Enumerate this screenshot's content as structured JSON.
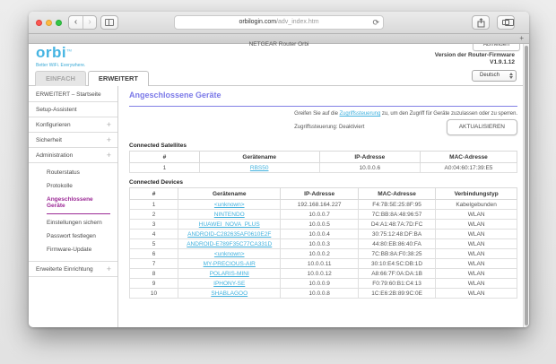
{
  "browser": {
    "url_domain": "orbilogin.com",
    "url_path": "/adv_index.htm",
    "tab_title": "NETGEAR Router Orbi",
    "back_glyph": "‹",
    "forward_glyph": "›",
    "reload_glyph": "⟳",
    "new_tab_glyph": "+"
  },
  "header": {
    "logo_text": "orbi",
    "logo_tm": "TM",
    "tagline": "Better WiFi. Everywhere.",
    "logout_label": "Abmelden",
    "firmware_label": "Version der Router-Firmware",
    "firmware_version": "V1.9.1.12",
    "language_selected": "Deutsch",
    "mode_tabs": {
      "simple": "EINFACH",
      "advanced": "ERWEITERT"
    }
  },
  "sidebar": {
    "items": [
      {
        "label": "ERWEITERT – Startseite",
        "expandable": false
      },
      {
        "label": "Setup-Assistent",
        "expandable": false
      },
      {
        "label": "Konfigurieren",
        "expandable": true
      },
      {
        "label": "Sicherheit",
        "expandable": true
      },
      {
        "label": "Administration",
        "expandable": true,
        "children": [
          "Routerstatus",
          "Protokolle",
          "Angeschlossene Geräte",
          "Einstellungen sichern",
          "Passwort festlegen",
          "Firmware-Update"
        ],
        "active_child": "Angeschlossene Geräte"
      },
      {
        "label": "Erweiterte Einrichtung",
        "expandable": true
      }
    ],
    "expand_glyph": "+"
  },
  "main": {
    "title": "Angeschlossene Geräte",
    "note_prefix": "Greifen Sie auf die ",
    "note_link": "Zugriffssteuerung",
    "note_suffix": " zu, um den Zugriff für Geräte zuzulassen oder zu sperren.",
    "status_line": "Zugriffssteuerung: Deaktiviert",
    "refresh_button": "AKTUALISIEREN",
    "satellites": {
      "label": "Connected Satellites",
      "headers": [
        "#",
        "Gerätename",
        "IP-Adresse",
        "MAC-Adresse"
      ],
      "rows": [
        [
          "1",
          "RBS50",
          "10.0.0.6",
          "A0:04:60:17:39:E5"
        ]
      ]
    },
    "devices": {
      "label": "Connected Devices",
      "headers": [
        "#",
        "Gerätename",
        "IP-Adresse",
        "MAC-Adresse",
        "Verbindungstyp"
      ],
      "rows": [
        [
          "1",
          "<unknown>",
          "192.168.164.227",
          "F4:7B:5E:25:8F:95",
          "Kabelgebunden"
        ],
        [
          "2",
          "NINTENDO",
          "10.0.0.7",
          "7C:BB:8A:48:96:57",
          "WLAN"
        ],
        [
          "3",
          "HUAWEI_NOVA_PLUS",
          "10.0.0.5",
          "D4:A1:48:7A:7D:FC",
          "WLAN"
        ],
        [
          "4",
          "ANDROID-C282635AF0610E2F",
          "10.0.0.4",
          "30:75:12:48:DF:BA",
          "WLAN"
        ],
        [
          "5",
          "ANDROID-E789F35C77CA331D",
          "10.0.0.3",
          "44:80:EB:86:40:FA",
          "WLAN"
        ],
        [
          "6",
          "<unknown>",
          "10.0.0.2",
          "7C:BB:8A:F0:38:25",
          "WLAN"
        ],
        [
          "7",
          "MY-PRECIOUS-AIR",
          "10.0.0.11",
          "30:10:E4:5C:DB:1D",
          "WLAN"
        ],
        [
          "8",
          "POLARIS-MINI",
          "10.0.0.12",
          "A8:66:7F:0A:DA:1B",
          "WLAN"
        ],
        [
          "9",
          "IPHONY-SE",
          "10.0.0.9",
          "F0:79:60:B1:C4:13",
          "WLAN"
        ],
        [
          "10",
          "SHABLAGOO",
          "10.0.0.8",
          "1C:E6:2B:89:9C:0E",
          "WLAN"
        ]
      ]
    }
  },
  "colors": {
    "accent_title": "#7b79e8",
    "link_blue": "#41b1de",
    "sidebar_active": "#9c2a96",
    "logo_blue": "#45b4e2"
  }
}
